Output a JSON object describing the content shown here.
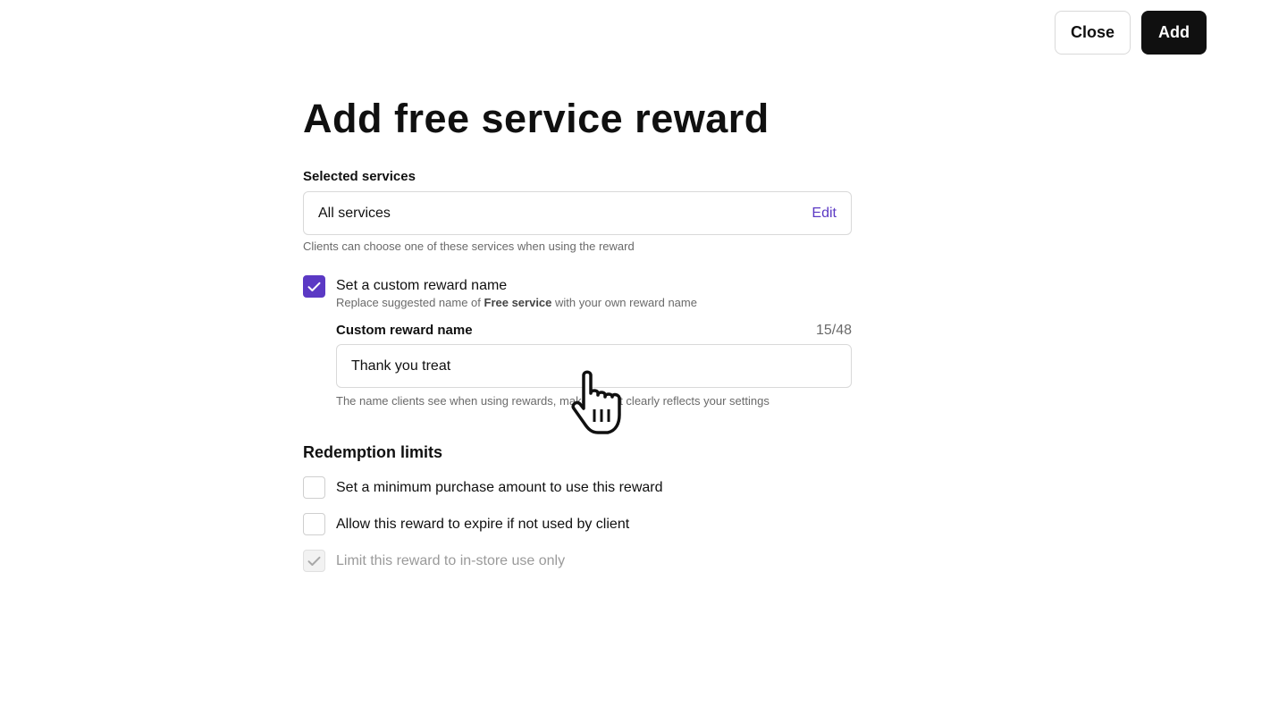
{
  "header": {
    "close_label": "Close",
    "add_label": "Add"
  },
  "page": {
    "title": "Add free service reward"
  },
  "selected_services": {
    "label": "Selected services",
    "value": "All services",
    "edit_label": "Edit",
    "help": "Clients can choose one of these services when using the reward"
  },
  "custom_name_option": {
    "checked": true,
    "label": "Set a custom reward name",
    "sub_prefix": "Replace suggested name of ",
    "sub_bold": "Free service",
    "sub_suffix": " with your own reward name"
  },
  "custom_name_field": {
    "label": "Custom reward name",
    "counter": "15/48",
    "value": "Thank you treat",
    "help": "The name clients see when using rewards, make sure it clearly reflects your settings"
  },
  "redemption": {
    "title": "Redemption limits",
    "options": [
      {
        "label": "Set a minimum purchase amount to use this reward",
        "checked": false,
        "disabled": false
      },
      {
        "label": "Allow this reward to expire if not used by client",
        "checked": false,
        "disabled": false
      },
      {
        "label": "Limit this reward to in-store use only",
        "checked": true,
        "disabled": true
      }
    ]
  },
  "colors": {
    "accent": "#5b39c4",
    "primary_button": "#101010",
    "border": "#d9d9d9"
  }
}
